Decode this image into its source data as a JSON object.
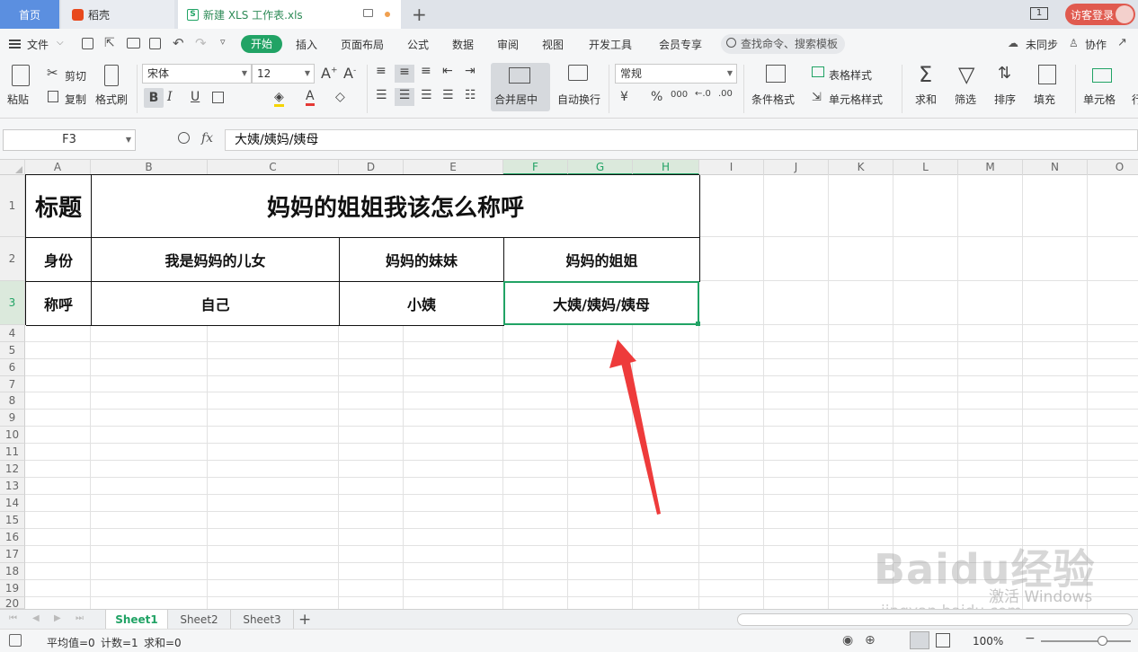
{
  "titlebar": {
    "home_tab": "首页",
    "daoke_tab": "稻壳",
    "doc_tab": "新建 XLS 工作表.xls",
    "doc_logo": "S",
    "new_tab": "+",
    "window_badge": "1",
    "visitor_login": "访客登录"
  },
  "menubar": {
    "file": "文件",
    "items": [
      "开始",
      "插入",
      "页面布局",
      "公式",
      "数据",
      "审阅",
      "视图",
      "开发工具",
      "会员专享"
    ],
    "search_placeholder": "查找命令、搜索模板",
    "sync": "未同步",
    "collab": "协作"
  },
  "ribbon": {
    "paste": "粘贴",
    "cut": "剪切",
    "copy": "复制",
    "format_painter": "格式刷",
    "font_name": "宋体",
    "font_size": "12",
    "bold": "B",
    "italic": "I",
    "underline": "U",
    "merge_center": "合并居中",
    "wrap_text": "自动换行",
    "number_format": "常规",
    "currency": "¥",
    "percent": "%",
    "thousands": "000",
    "conditional_format": "条件格式",
    "table_style": "表格样式",
    "cell_style": "单元格样式",
    "sum": "求和",
    "filter": "筛选",
    "sort": "排序",
    "fill": "填充",
    "cell": "单元格",
    "row_col": "行"
  },
  "formula_bar": {
    "name_box": "F3",
    "fx": "fx",
    "content": "大姨/姨妈/姨母"
  },
  "columns": [
    "A",
    "B",
    "C",
    "D",
    "E",
    "F",
    "G",
    "H",
    "I",
    "J",
    "K",
    "L",
    "M",
    "N",
    "O"
  ],
  "rows": [
    "1",
    "2",
    "3",
    "4",
    "5",
    "6",
    "7",
    "8",
    "9",
    "10",
    "11",
    "12",
    "13",
    "14",
    "15",
    "16",
    "17",
    "18",
    "19",
    "20"
  ],
  "table": {
    "r1_label": "标题",
    "r1_title": "妈妈的姐姐我该怎么称呼",
    "r2_label": "身份",
    "r2_c1": "我是妈妈的儿女",
    "r2_c2": "妈妈的妹妹",
    "r2_c3": "妈妈的姐姐",
    "r3_label": "称呼",
    "r3_c1": "自己",
    "r3_c2": "小姨",
    "r3_c3": "大姨/姨妈/姨母"
  },
  "sheets": [
    "Sheet1",
    "Sheet2",
    "Sheet3"
  ],
  "add_sheet": "+",
  "status": {
    "average": "平均值=0",
    "count": "计数=1",
    "sum": "求和=0",
    "zoom": "100%"
  },
  "watermark": {
    "logo": "Baidu经验",
    "url": "jingyan.baidu.com",
    "windows": "激活 Windows"
  },
  "colors": {
    "accent": "#21a365",
    "visitor": "#e05a4f",
    "arrow": "#ee3b3b"
  }
}
